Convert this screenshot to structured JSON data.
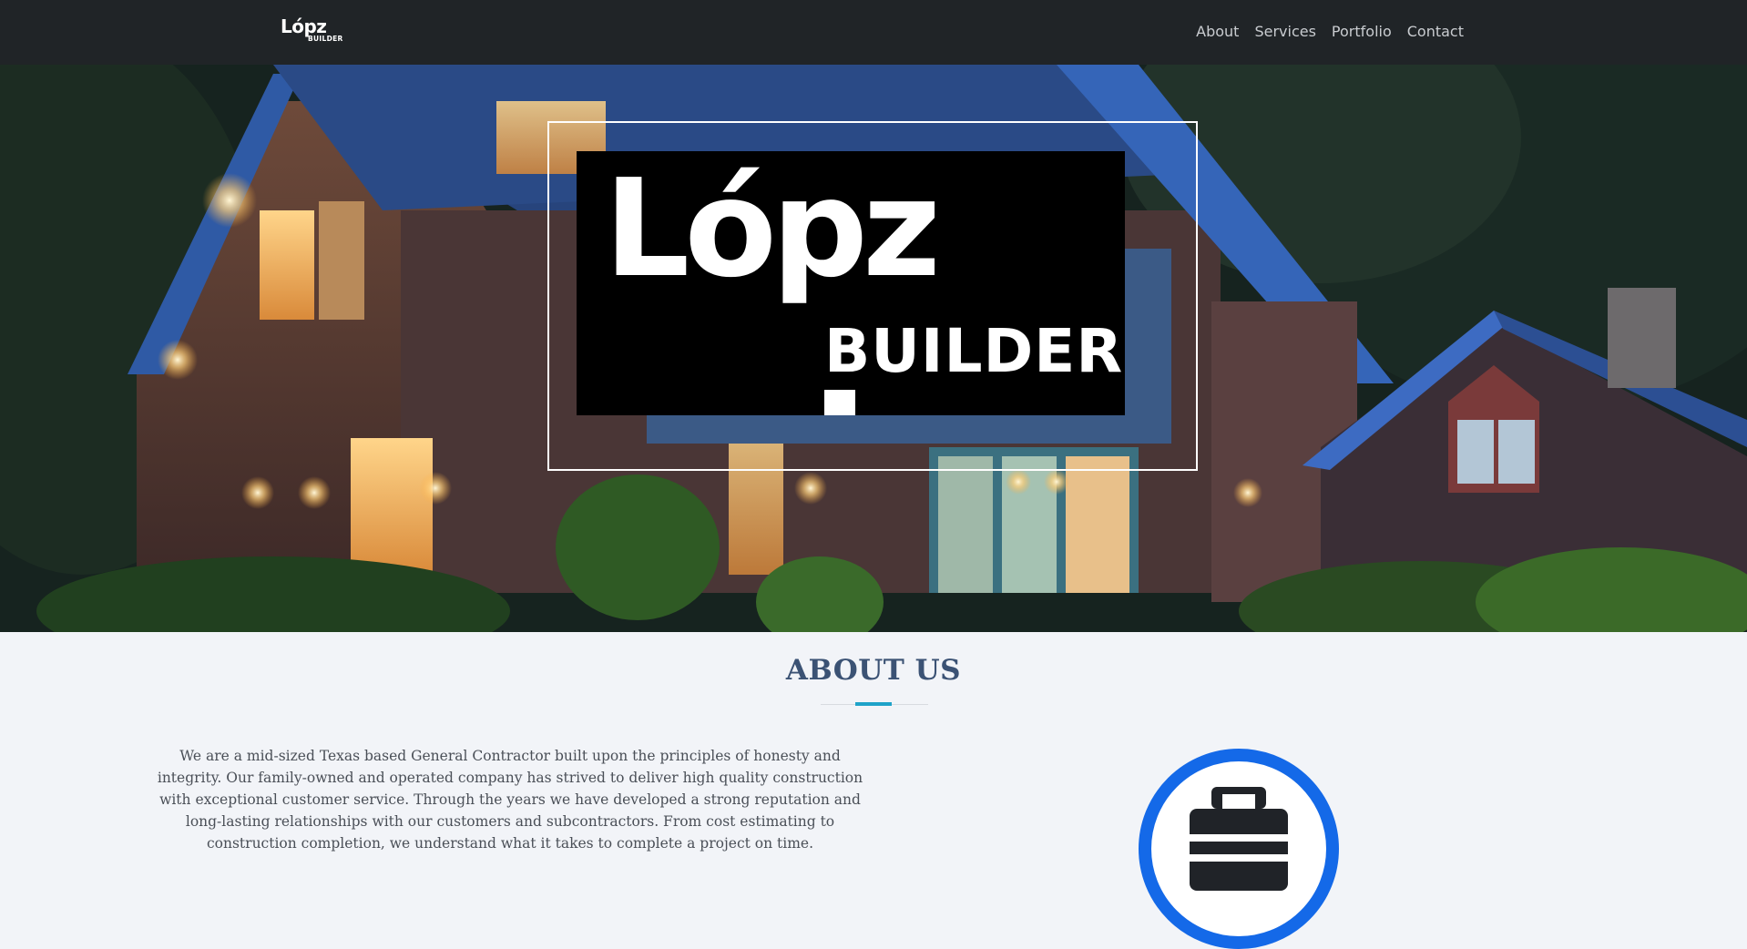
{
  "navbar": {
    "brand": {
      "name": "Lópz",
      "sub": "BUILDER"
    },
    "links": [
      "About",
      "Services",
      "Portfolio",
      "Contact"
    ]
  },
  "hero": {
    "logo": {
      "name": "Lópz",
      "sub": "BUILDER"
    }
  },
  "about": {
    "title": "ABOUT US",
    "text": "We are a mid-sized Texas based General Contractor built upon the principles of honesty and integrity. Our family-owned and operated company has strived to deliver high quality construction with exceptional customer service. Through the years we have developed a strong reputation and long-lasting relationships with our customers and subcontractors. From cost estimating to construction completion, we understand what it takes to complete a project on time.",
    "icon": "toolbox-icon"
  },
  "colors": {
    "navbar": "#202427",
    "accent": "#1fa3c9",
    "heading": "#3b5274",
    "badge": "#1469e8",
    "logo_shadow": "#3b5a86"
  }
}
